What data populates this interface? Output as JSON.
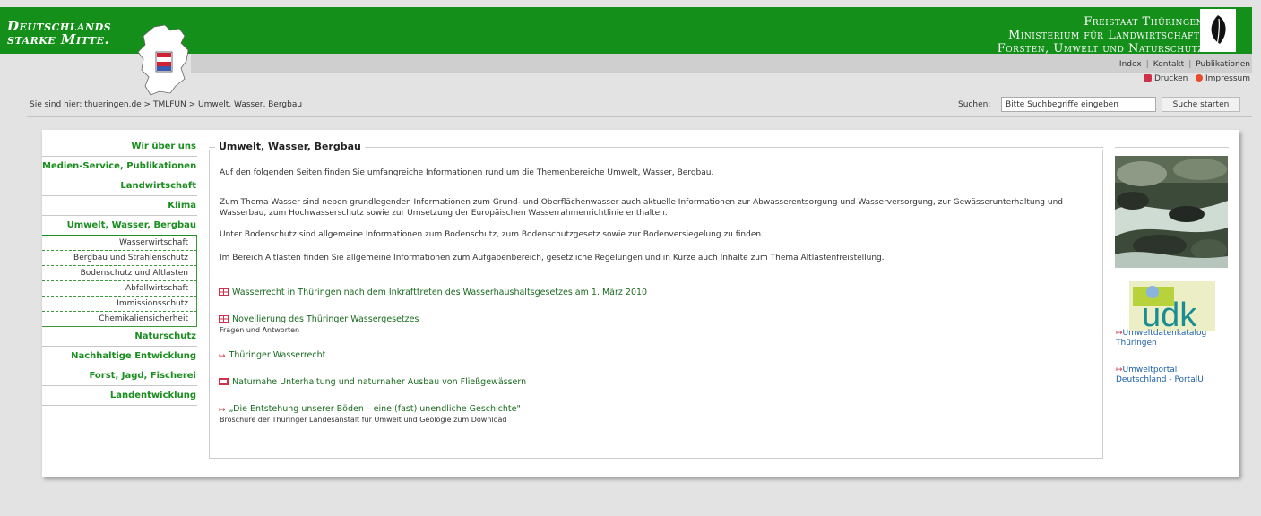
{
  "header": {
    "brand_line1": "Deutschlands",
    "brand_line2": "starke Mitte.",
    "ministry_line1": "Freistaat Thüringen",
    "ministry_line2": "Ministerium für Landwirtschaft,",
    "ministry_line3": "Forsten, Umwelt und Naturschutz"
  },
  "toplinks": {
    "index": "Index",
    "kontakt": "Kontakt",
    "publikationen": "Publikationen",
    "sep": "|",
    "drucken": "Drucken",
    "impressum": "Impressum"
  },
  "breadcrumb": "Sie sind hier:  thueringen.de  >  TMLFUN  >  Umwelt, Wasser, Bergbau",
  "search": {
    "label": "Suchen:",
    "value": "Bitte Suchbegriffe eingeben",
    "button": "Suche starten"
  },
  "nav": {
    "items": [
      "Wir über uns",
      "Medien-Service, Publikationen",
      "Landwirtschaft",
      "Klima",
      "Umwelt, Wasser, Bergbau"
    ],
    "subitems": [
      "Wasserwirtschaft",
      "Bergbau und Strahlenschutz",
      "Bodenschutz und Altlasten",
      "Abfallwirtschaft",
      "Immissionsschutz",
      "Chemikaliensicherheit"
    ],
    "items_after": [
      "Naturschutz",
      "Nachhaltige Entwicklung",
      "Forst, Jagd, Fischerei",
      "Landentwicklung"
    ]
  },
  "main": {
    "title": "Umwelt, Wasser, Bergbau",
    "paragraphs": [
      "Auf den folgenden Seiten finden Sie umfangreiche Informationen rund um die Themenbereiche Umwelt, Wasser, Bergbau.",
      "Zum Thema Wasser sind neben grundlegenden Informationen zum Grund- und Oberflächenwasser auch aktuelle Informationen zur Abwasserentsorgung und Wasserversorgung, zur Gewässerunterhaltung und Wasserbau, zum Hochwasserschutz sowie zur Umsetzung der Europäischen Wasserrahmenrichtlinie enthalten.",
      "Unter Bodenschutz sind allgemeine Informationen zum Bodenschutz, zum Bodenschutzgesetz sowie zur Bodenversiegelung zu finden.",
      "Im Bereich Altlasten finden Sie allgemeine Informationen zum Aufgabenbereich, gesetzliche Regelungen und in Kürze auch Inhalte zum Thema Altlastenfreistellung."
    ],
    "links": [
      {
        "text": "Wasserrecht in Thüringen nach dem Inkrafttreten des Wasserhaushaltsgesetzes am 1. März 2010",
        "sub": ""
      },
      {
        "text": "Novellierung des Thüringer Wassergesetzes",
        "sub": "Fragen und Antworten"
      },
      {
        "text": "Thüringer Wasserrecht",
        "sub": ""
      },
      {
        "text": "Naturnahe Unterhaltung und naturnaher Ausbau von Fließgewässern",
        "sub": ""
      },
      {
        "text": "„Die Entstehung unserer Böden – eine (fast) unendliche Geschichte\"",
        "sub": "Broschüre der Thüringer Landesanstalt für Umwelt und Geologie zum Download"
      }
    ]
  },
  "right": {
    "udk_logo": "udk",
    "link1_line1": "Umweltdatenkatalog",
    "link1_line2": "Thüringen",
    "link2_line1": "Umweltportal",
    "link2_line2": "Deutschland - PortalU",
    "arrow": "↦"
  },
  "colors": {
    "header_green": "#14901a",
    "nav_green": "#1a8e1f",
    "link_red": "#d0304a"
  }
}
